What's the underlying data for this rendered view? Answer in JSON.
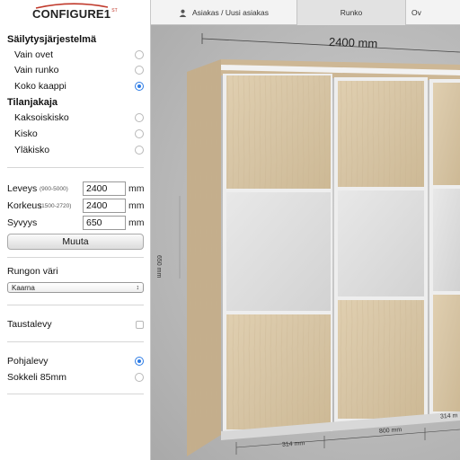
{
  "app": {
    "logo": "CONFIGURE1",
    "logo_sup": "ST"
  },
  "topbar": {
    "tabs": [
      {
        "label": "Asiakas / Uusi asiakas",
        "icon": "user-icon"
      },
      {
        "label": "Runko",
        "active": true
      },
      {
        "label": "Ov"
      }
    ]
  },
  "sidebar": {
    "system": {
      "title": "Säilytysjärjestelmä",
      "options": [
        {
          "label": "Vain ovet",
          "selected": false
        },
        {
          "label": "Vain runko",
          "selected": false
        },
        {
          "label": "Koko kaappi",
          "selected": true
        }
      ]
    },
    "divider": {
      "title": "Tilanjakaja",
      "options": [
        {
          "label": "Kaksoiskisko",
          "selected": false
        },
        {
          "label": "Kisko",
          "selected": false
        },
        {
          "label": "Yläkisko",
          "selected": false
        }
      ]
    },
    "dimensions": [
      {
        "name": "Leveys",
        "range": "(900-5000)",
        "value": "2400",
        "unit": "mm"
      },
      {
        "name": "Korkeus",
        "range": "(1500-2720)",
        "value": "2400",
        "unit": "mm"
      },
      {
        "name": "Syvyys",
        "range": "",
        "value": "650",
        "unit": "mm"
      }
    ],
    "apply_button": "Muuta",
    "frame_color": {
      "label": "Rungon väri",
      "selected": "Kaarna"
    },
    "back_panel": {
      "label": "Taustalevy",
      "checked": false
    },
    "base": {
      "options": [
        {
          "label": "Pohjalevy",
          "selected": true
        },
        {
          "label": "Sokkeli 85mm",
          "selected": false
        }
      ]
    }
  },
  "viewport": {
    "width_label": "2400 mm",
    "depth_label": "650 mm",
    "bottom_labels": [
      "314 mm",
      "800 mm",
      "314 m"
    ]
  },
  "colors": {
    "accent": "#2c7be5",
    "wood": "#d9c8aa",
    "frame": "#cbb79a",
    "glass": "#dcdcdc"
  }
}
